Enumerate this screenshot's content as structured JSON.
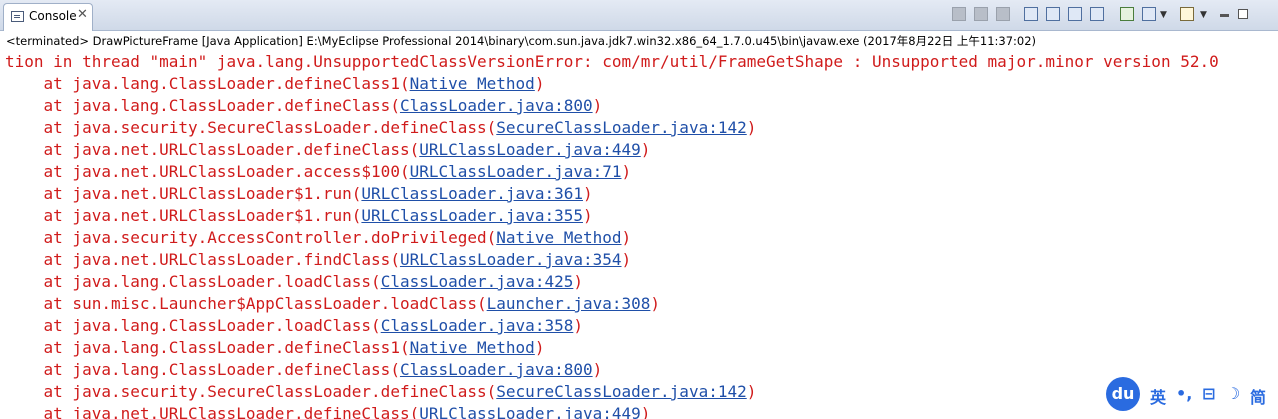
{
  "tab": {
    "label": "Console",
    "close": "✕"
  },
  "toolbar": {
    "icons": [
      "terminate-icon",
      "remove-launch-icon",
      "remove-all-icon",
      "scroll-lock-icon",
      "word-wrap-icon",
      "show-console-stdout-icon",
      "show-console-stderr-icon",
      "pin-console-icon",
      "display-selected-console-icon",
      "open-console-icon",
      "view-menu-icon",
      "minimize-icon",
      "maximize-icon"
    ]
  },
  "status_line": "<terminated> DrawPictureFrame [Java Application] E:\\MyEclipse Professional 2014\\binary\\com.sun.java.jdk7.win32.x86_64_1.7.0.u45\\bin\\javaw.exe (2017年8月22日 上午11:37:02)",
  "console": {
    "first_line": "tion in thread \"main\" java.lang.UnsupportedClassVersionError: com/mr/util/FrameGetShape : Unsupported major.minor version 52.0",
    "frames": [
      {
        "text": "    at java.lang.ClassLoader.defineClass1(",
        "link": "Native Method",
        "end": ")"
      },
      {
        "text": "    at java.lang.ClassLoader.defineClass(",
        "link": "ClassLoader.java:800",
        "end": ")"
      },
      {
        "text": "    at java.security.SecureClassLoader.defineClass(",
        "link": "SecureClassLoader.java:142",
        "end": ")"
      },
      {
        "text": "    at java.net.URLClassLoader.defineClass(",
        "link": "URLClassLoader.java:449",
        "end": ")"
      },
      {
        "text": "    at java.net.URLClassLoader.access$100(",
        "link": "URLClassLoader.java:71",
        "end": ")"
      },
      {
        "text": "    at java.net.URLClassLoader$1.run(",
        "link": "URLClassLoader.java:361",
        "end": ")"
      },
      {
        "text": "    at java.net.URLClassLoader$1.run(",
        "link": "URLClassLoader.java:355",
        "end": ")"
      },
      {
        "text": "    at java.security.AccessController.doPrivileged(",
        "link": "Native Method",
        "end": ")"
      },
      {
        "text": "    at java.net.URLClassLoader.findClass(",
        "link": "URLClassLoader.java:354",
        "end": ")"
      },
      {
        "text": "    at java.lang.ClassLoader.loadClass(",
        "link": "ClassLoader.java:425",
        "end": ")"
      },
      {
        "text": "    at sun.misc.Launcher$AppClassLoader.loadClass(",
        "link": "Launcher.java:308",
        "end": ")"
      },
      {
        "text": "    at java.lang.ClassLoader.loadClass(",
        "link": "ClassLoader.java:358",
        "end": ")"
      },
      {
        "text": "    at java.lang.ClassLoader.defineClass1(",
        "link": "Native Method",
        "end": ")"
      },
      {
        "text": "    at java.lang.ClassLoader.defineClass(",
        "link": "ClassLoader.java:800",
        "end": ")"
      },
      {
        "text": "    at java.security.SecureClassLoader.defineClass(",
        "link": "SecureClassLoader.java:142",
        "end": ")"
      },
      {
        "text": "    at java.net.URLClassLoader.defineClass(",
        "link": "URLClassLoader.java:449",
        "end": ")"
      }
    ]
  },
  "ime": {
    "logo": "du",
    "items": [
      "英",
      "•,",
      "⊟",
      "☽",
      "简"
    ]
  },
  "colors": {
    "error_text": "#d01b1b",
    "link": "#1f4fa8",
    "ime_blue": "#2a6be0"
  }
}
